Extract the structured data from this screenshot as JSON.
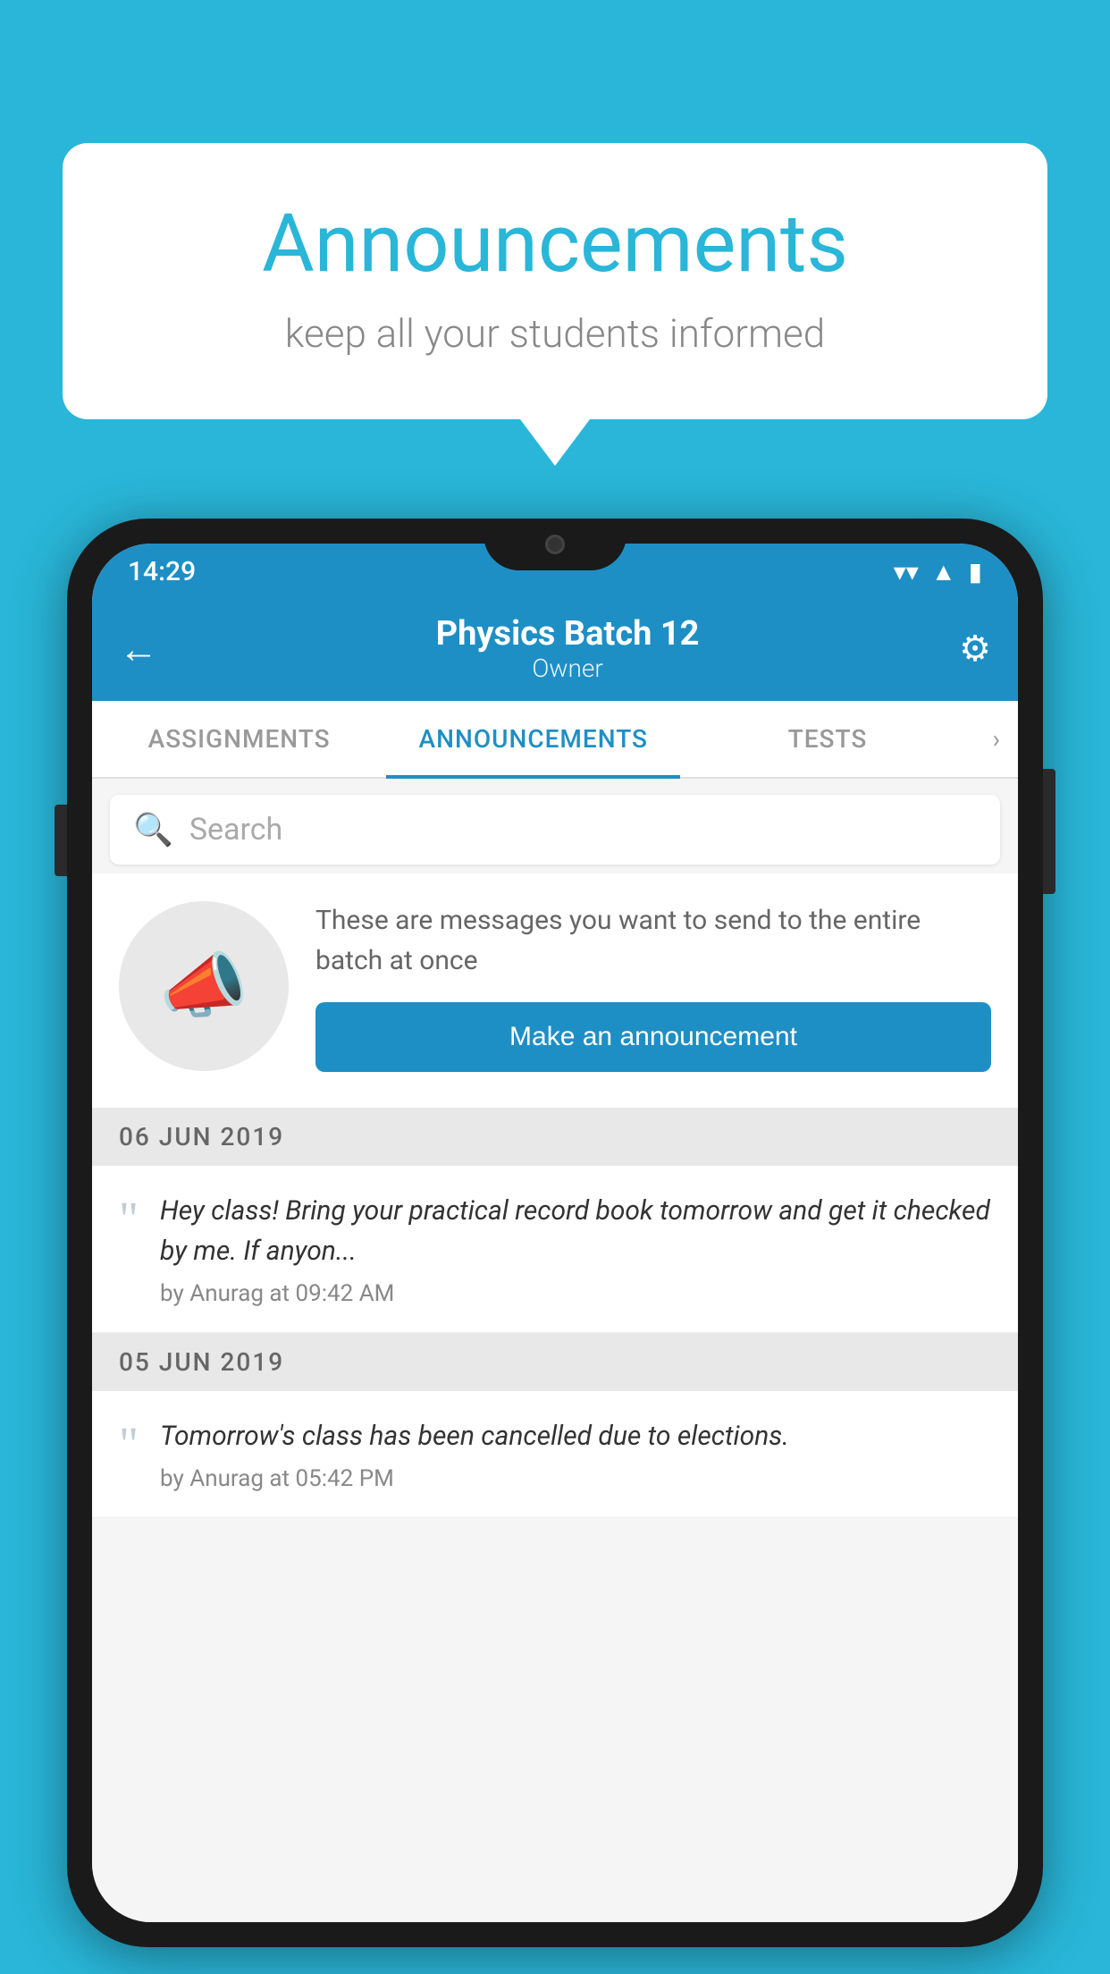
{
  "bubble": {
    "title": "Announcements",
    "subtitle": "keep all your students informed"
  },
  "statusBar": {
    "time": "14:29",
    "wifiIcon": "▼",
    "signalIcon": "▲",
    "batteryIcon": "▮"
  },
  "appBar": {
    "title": "Physics Batch 12",
    "subtitle": "Owner",
    "backLabel": "←",
    "settingsLabel": "⚙"
  },
  "tabs": [
    {
      "label": "ASSIGNMENTS",
      "active": false
    },
    {
      "label": "ANNOUNCEMENTS",
      "active": true
    },
    {
      "label": "TESTS",
      "active": false
    }
  ],
  "search": {
    "placeholder": "Search"
  },
  "announcementPrompt": {
    "description": "These are messages you want to send to the entire batch at once",
    "buttonLabel": "Make an announcement"
  },
  "dateGroups": [
    {
      "date": "06  JUN  2019",
      "items": [
        {
          "message": "Hey class! Bring your practical record book tomorrow and get it checked by me. If anyon...",
          "meta": "by Anurag at 09:42 AM"
        }
      ]
    },
    {
      "date": "05  JUN  2019",
      "items": [
        {
          "message": "Tomorrow's class has been cancelled due to elections.",
          "meta": "by Anurag at 05:42 PM"
        }
      ]
    }
  ]
}
